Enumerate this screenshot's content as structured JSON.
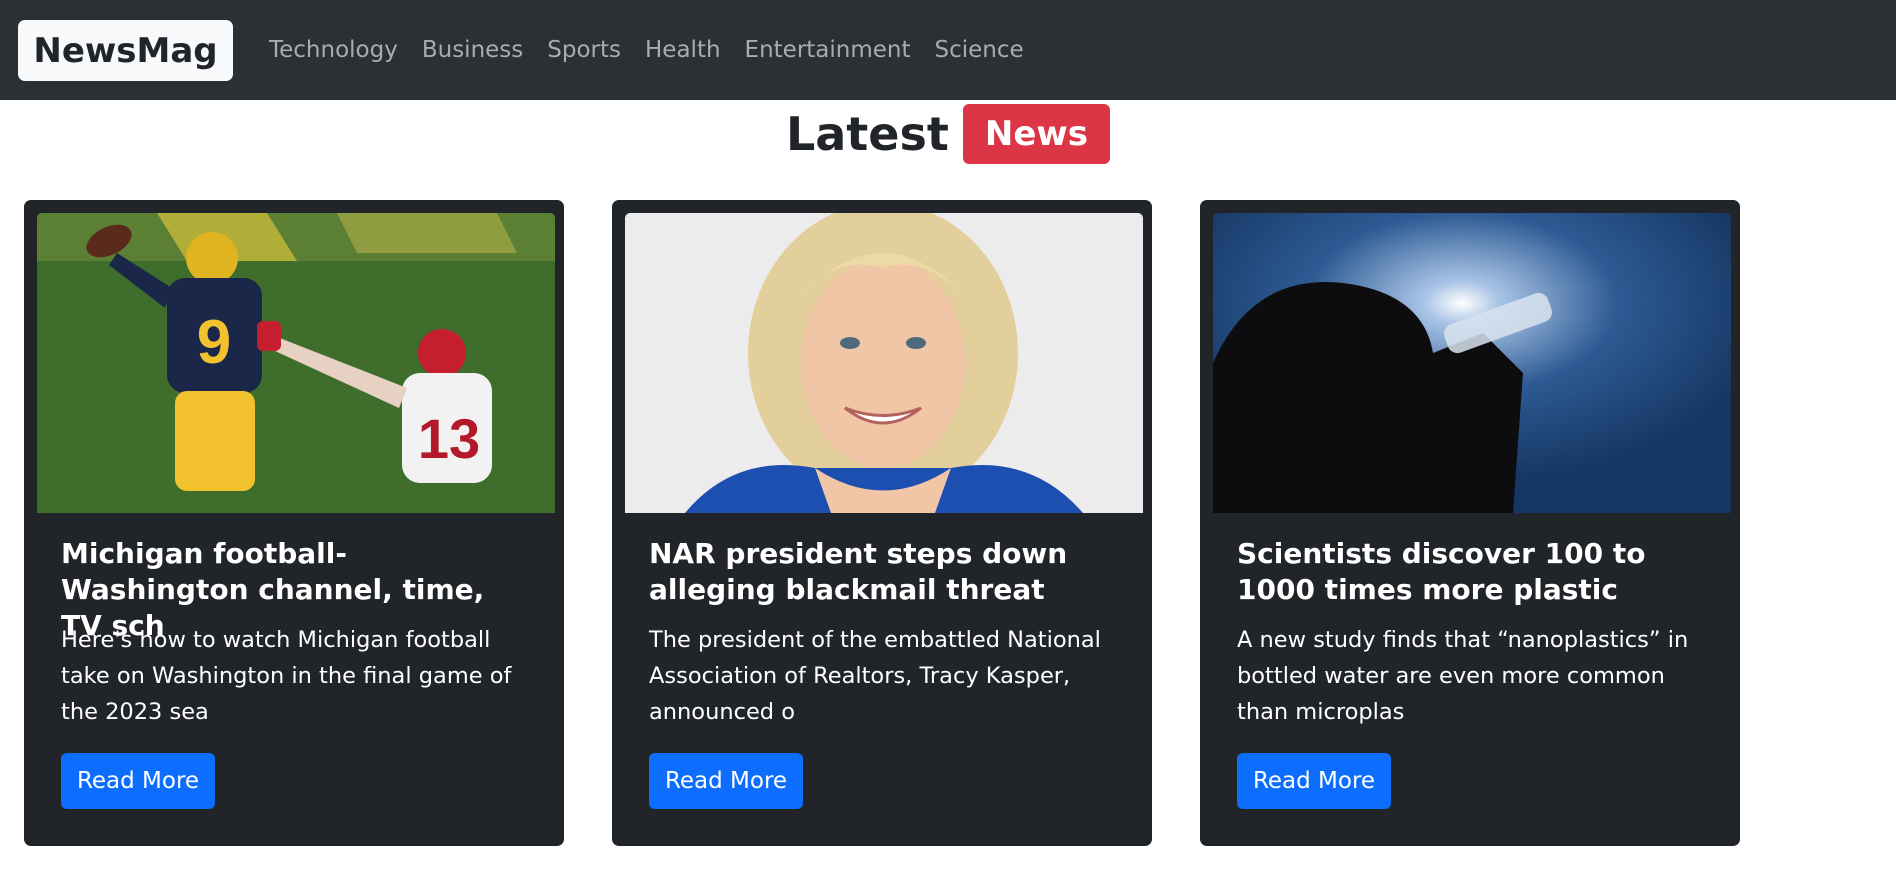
{
  "navbar": {
    "brand": "NewsMag",
    "links": [
      "Technology",
      "Business",
      "Sports",
      "Health",
      "Entertainment",
      "Science"
    ]
  },
  "heading": {
    "text": "Latest",
    "badge": "News"
  },
  "cards": [
    {
      "title": "Michigan football-Washington channel, time, TV sch",
      "description": "Here's how to watch Michigan football take on Washington in the final game of the 2023 sea",
      "button": "Read More",
      "image_alt": "football game photo",
      "jersey_numbers": [
        "9",
        "13"
      ]
    },
    {
      "title": "NAR president steps down alleging blackmail threat",
      "description": "The president of the embattled National Association of Realtors, Tracy Kasper, announced o",
      "button": "Read More",
      "image_alt": "portrait photo"
    },
    {
      "title": "Scientists discover 100 to 1000 times more plastic",
      "description": "A new study finds that “nanoplastics” in bottled water are even more common than microplas",
      "button": "Read More",
      "image_alt": "person drinking water silhouette"
    }
  ],
  "colors": {
    "navbar_bg": "#2b3035",
    "card_bg": "#212529",
    "badge_bg": "#dc3545",
    "button_bg": "#0d6efd"
  }
}
